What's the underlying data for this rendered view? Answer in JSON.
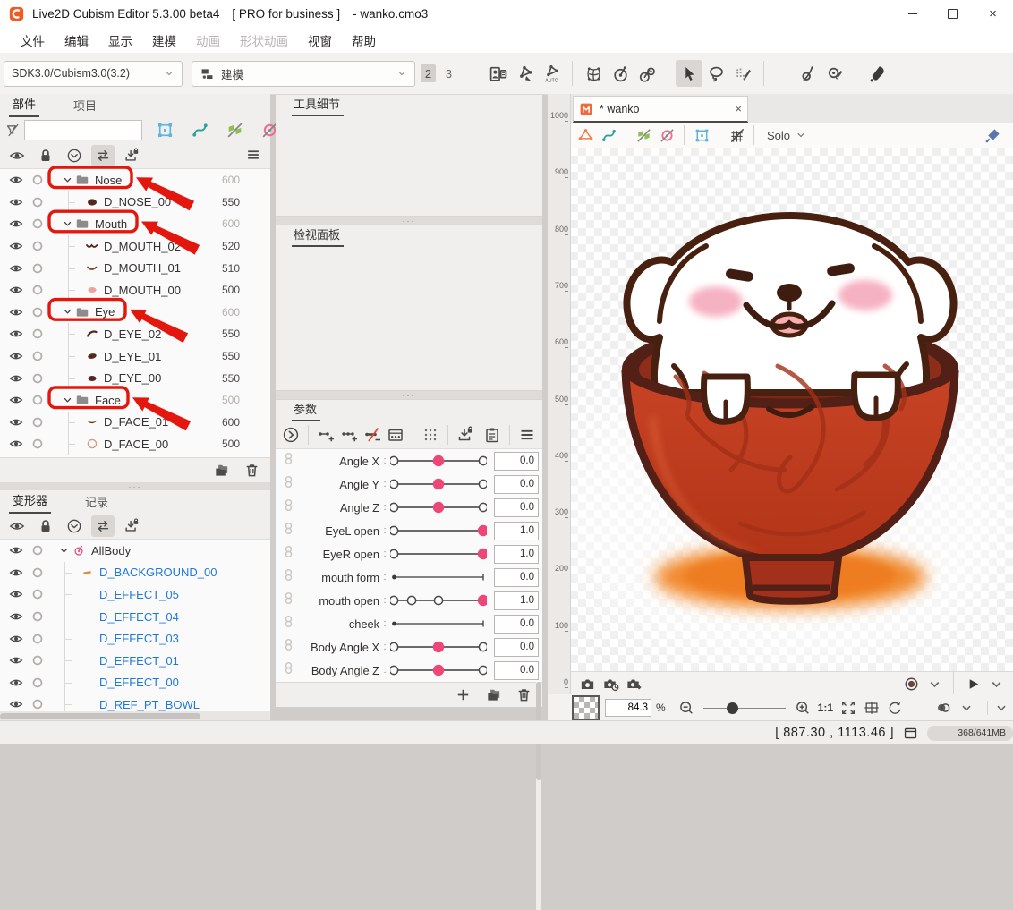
{
  "window": {
    "title": "Live2D Cubism Editor 5.3.00 beta4",
    "license": "[ PRO for business ]",
    "filename": "- wanko.cmo3",
    "close_glyph": "×"
  },
  "menubar": {
    "items": [
      {
        "label": "文件",
        "enabled": true
      },
      {
        "label": "编辑",
        "enabled": true
      },
      {
        "label": "显示",
        "enabled": true
      },
      {
        "label": "建模",
        "enabled": true
      },
      {
        "label": "动画",
        "enabled": false
      },
      {
        "label": "形状动画",
        "enabled": false
      },
      {
        "label": "视窗",
        "enabled": true
      },
      {
        "label": "帮助",
        "enabled": true
      }
    ]
  },
  "toolbar": {
    "sdk_select": "SDK3.0/Cubism3.0(3.2)",
    "workspace_select": "建模",
    "view_level_selected": "2",
    "view_level": "3",
    "selected_tool": "arrow-tool",
    "groups": [
      [
        "id-palette",
        "mesh-edit",
        "mesh-auto"
      ],
      [
        "warp-deformer",
        "rotation-deformer",
        "multi-deformer"
      ],
      [
        "arrow-tool",
        "lasso-tool",
        "brush-select-tool"
      ],
      [
        "glue-tool",
        "glue-brush-tool"
      ],
      [
        "dropper-tool"
      ]
    ]
  },
  "parts_panel": {
    "tabs": [
      {
        "label": "部件",
        "active": true
      },
      {
        "label": "项目",
        "active": false
      }
    ],
    "search_value": "",
    "filter_icon": "filter-off",
    "filter_icons": [
      "texture-bounds",
      "path-edit",
      "mesh-visibility",
      "deformer-visibility",
      "pin"
    ],
    "list_icons": [
      "eye",
      "lock",
      "circle-chevron",
      "swap",
      "import-lock"
    ],
    "list_selected": "swap",
    "menu_icon": "menu",
    "tree": [
      {
        "label": "Nose",
        "kind": "folder",
        "value": "600",
        "annotated": true
      },
      {
        "label": "D_NOSE_00",
        "kind": "item",
        "thumb": "nose",
        "value": "550"
      },
      {
        "label": "Mouth",
        "kind": "folder",
        "value": "600",
        "annotated": true
      },
      {
        "label": "D_MOUTH_02",
        "kind": "item",
        "thumb": "mouth2",
        "value": "520"
      },
      {
        "label": "D_MOUTH_01",
        "kind": "item",
        "thumb": "mouth1",
        "value": "510"
      },
      {
        "label": "D_MOUTH_00",
        "kind": "item",
        "thumb": "mouth0",
        "value": "500"
      },
      {
        "label": "Eye",
        "kind": "folder",
        "value": "600",
        "annotated": true
      },
      {
        "label": "D_EYE_02",
        "kind": "item",
        "thumb": "eye2",
        "value": "550"
      },
      {
        "label": "D_EYE_01",
        "kind": "item",
        "thumb": "eye1",
        "value": "550"
      },
      {
        "label": "D_EYE_00",
        "kind": "item",
        "thumb": "eye0",
        "value": "550"
      },
      {
        "label": "Face",
        "kind": "folder",
        "value": "500",
        "annotated": true
      },
      {
        "label": "D_FACE_01",
        "kind": "item",
        "thumb": "face1",
        "value": "600"
      },
      {
        "label": "D_FACE_00",
        "kind": "item",
        "thumb": "face0",
        "value": "500"
      }
    ],
    "footer_icons": [
      "duplicate",
      "delete"
    ]
  },
  "deformer_panel": {
    "tabs": [
      {
        "label": "变形器",
        "active": true
      },
      {
        "label": "记录",
        "active": false
      }
    ],
    "list_icons": [
      "eye",
      "lock",
      "circle-chevron",
      "swap",
      "import-lock"
    ],
    "list_selected": "swap",
    "tree": [
      {
        "label": "AllBody",
        "kind": "root",
        "icon": "rotation-deformer-pink"
      },
      {
        "label": "D_BACKGROUND_00",
        "kind": "child",
        "icon": "art-mesh-dash"
      },
      {
        "label": "D_EFFECT_05",
        "kind": "child"
      },
      {
        "label": "D_EFFECT_04",
        "kind": "child"
      },
      {
        "label": "D_EFFECT_03",
        "kind": "child"
      },
      {
        "label": "D_EFFECT_01",
        "kind": "child"
      },
      {
        "label": "D_EFFECT_00",
        "kind": "child"
      },
      {
        "label": "D_REF_PT_BOWL",
        "kind": "child"
      }
    ]
  },
  "panels": {
    "tool_detail": "工具细节",
    "inspector": "检视面板",
    "parameter": "参数"
  },
  "param_toolbar": {
    "groups": [
      [
        "key-circle"
      ],
      [
        "add-key1",
        "add-key3",
        "del-key",
        "key-panel"
      ],
      [
        "dots-grid"
      ],
      [
        "import-lock"
      ]
    ],
    "right": [
      "clipboard",
      "menu"
    ]
  },
  "parameters": [
    {
      "label": "Angle X",
      "value": "0.0",
      "style": "center"
    },
    {
      "label": "Angle Y",
      "value": "0.0",
      "style": "center"
    },
    {
      "label": "Angle Z",
      "value": "0.0",
      "style": "center"
    },
    {
      "label": "EyeL open",
      "value": "1.0",
      "style": "right"
    },
    {
      "label": "EyeR open",
      "value": "1.0",
      "style": "right"
    },
    {
      "label": "mouth form",
      "value": "0.0",
      "style": "mono"
    },
    {
      "label": "mouth open",
      "value": "1.0",
      "style": "multi"
    },
    {
      "label": "cheek",
      "value": "0.0",
      "style": "mono"
    },
    {
      "label": "Body Angle X",
      "value": "0.0",
      "style": "center"
    },
    {
      "label": "Body Angle Z",
      "value": "0.0",
      "style": "center"
    }
  ],
  "param_footer_icons": [
    "add",
    "duplicate",
    "delete"
  ],
  "canvas": {
    "tab": {
      "icon": "model-doc",
      "label": "* wanko",
      "close": "×"
    },
    "toolbar_groups": [
      [
        "mesh-tri",
        "path-edit"
      ],
      [
        "mesh-visibility",
        "deformer-visibility"
      ],
      [
        "texture-bounds"
      ],
      [
        "grid-off"
      ]
    ],
    "solo_label": "Solo",
    "ruler_labels": [
      "1000",
      "900",
      "800",
      "700",
      "600",
      "500",
      "400",
      "300",
      "200",
      "100",
      "0"
    ],
    "capture_icons": [
      "camera",
      "camera-time",
      "camera-export"
    ],
    "zoom_value": "84.3",
    "zoom_unit": "%",
    "scale_label": "1:1",
    "coords": "[ 887.30 , 1113.46 ]",
    "memory": "368/641MB"
  },
  "colors": {
    "accent_pink": "#ee4677",
    "annotation_red": "#e3170d",
    "link_blue": "#1f78e0",
    "bowl_red": "#c63f22",
    "shadow_orange": "#f18a2f"
  }
}
